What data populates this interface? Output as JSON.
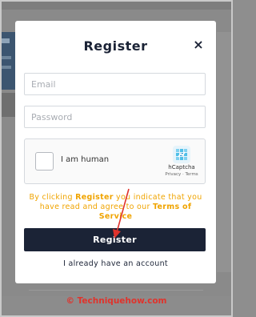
{
  "modal": {
    "title": "Register",
    "close_symbol": "×"
  },
  "form": {
    "email_placeholder": "Email",
    "password_placeholder": "Password"
  },
  "captcha": {
    "label": "I am human",
    "brand": "hCaptcha",
    "links": "Privacy · Terms"
  },
  "terms": {
    "part1": "By clicking ",
    "register_word": "Register",
    "part2": " you indicate that you have read and agree to our ",
    "terms_link": "Terms of Service"
  },
  "actions": {
    "register_label": "Register",
    "login_link": "I already have an account"
  },
  "watermark": {
    "text": "© Techniquehow.com"
  },
  "colors": {
    "primary_navy": "#1b2336",
    "terms_orange": "#f0a400",
    "annotation_red": "#e0332c",
    "overlay_gray": "#8a8a8a"
  },
  "icons": [
    "close-icon",
    "hcaptcha-logo-icon",
    "annotation-arrow"
  ]
}
